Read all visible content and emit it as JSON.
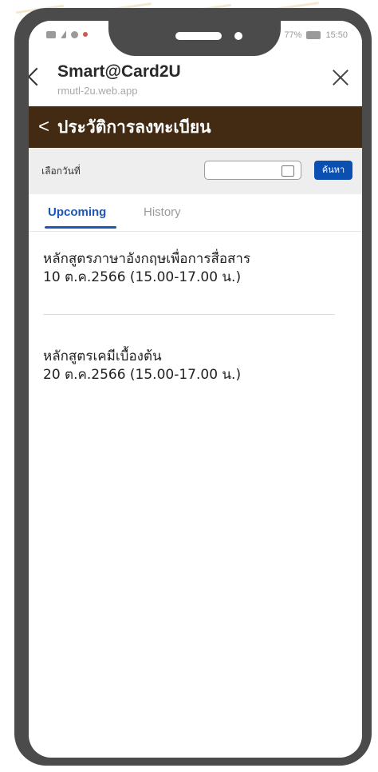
{
  "status_bar": {
    "battery": "77%",
    "time": "15:50"
  },
  "app_bar": {
    "title": "Smart@Card2U",
    "subtitle": "rmutl-2u.web.app"
  },
  "page_header": {
    "back_symbol": "<",
    "title": "ประวัติการลงทะเบียน"
  },
  "filter": {
    "label": "เลือกวันที่",
    "date_value": "",
    "search_button": "ค้นหา"
  },
  "tabs": [
    {
      "label": "Upcoming",
      "active": true
    },
    {
      "label": "History",
      "active": false
    }
  ],
  "courses": [
    {
      "name": "หลักสูตรภาษาอังกฤษเพื่อการสื่อสาร",
      "schedule": "10 ต.ค.2566 (15.00-17.00 น.)"
    },
    {
      "name": "หลักสูตรเคมีเบื้องต้น",
      "schedule": "20 ต.ค.2566 (15.00-17.00 น.)"
    }
  ],
  "colors": {
    "header_brown": "#422b12",
    "accent_blue": "#1d57b6",
    "button_blue": "#0b4fb0",
    "phone_frame": "#4b4b4b"
  }
}
